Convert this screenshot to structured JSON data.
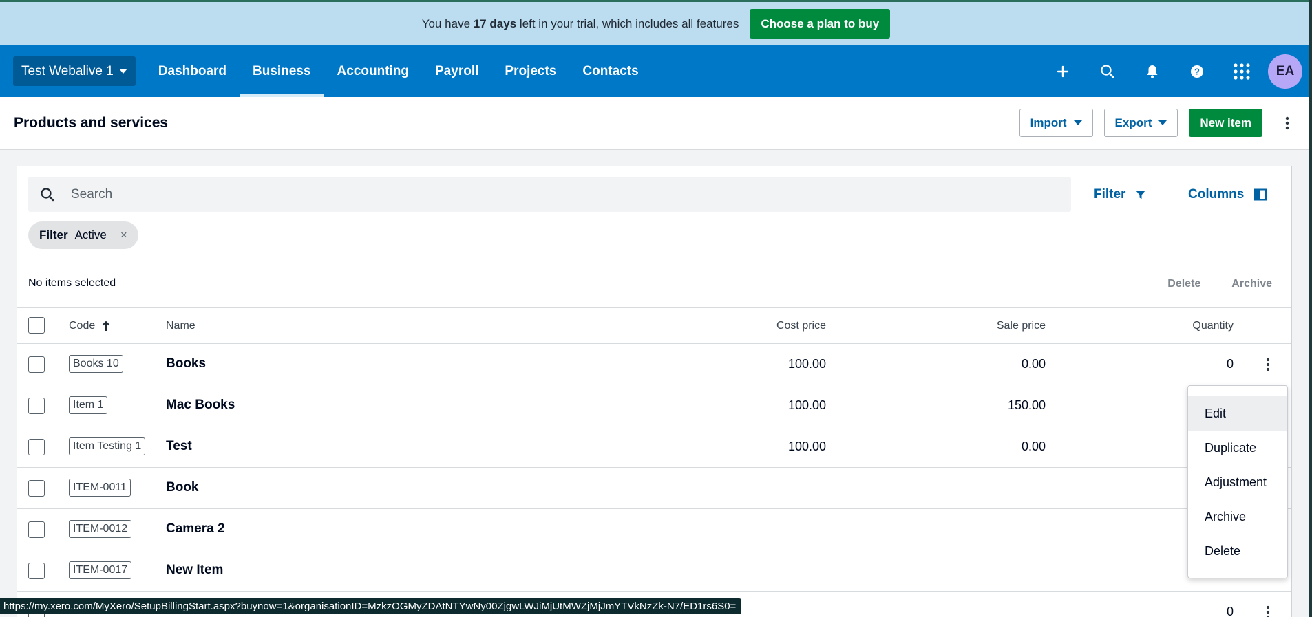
{
  "trial": {
    "pre": "You have",
    "days": "17 days",
    "post": "left in your trial, which includes all features",
    "cta": "Choose a plan to buy"
  },
  "nav": {
    "org": "Test Webalive 1",
    "links": [
      "Dashboard",
      "Business",
      "Accounting",
      "Payroll",
      "Projects",
      "Contacts"
    ],
    "active": "Business",
    "avatar": "EA",
    "accent": "#0078c8"
  },
  "page": {
    "title": "Products and services",
    "import": "Import",
    "export": "Export",
    "new_item": "New item"
  },
  "toolbar": {
    "search_placeholder": "Search",
    "filter": "Filter",
    "columns": "Columns"
  },
  "chip": {
    "label": "Filter",
    "value": "Active",
    "remove": "×"
  },
  "selection": {
    "text": "No items selected",
    "delete": "Delete",
    "archive": "Archive"
  },
  "table": {
    "headers": {
      "code": "Code",
      "name": "Name",
      "cost": "Cost price",
      "sale": "Sale price",
      "qty": "Quantity"
    },
    "rows": [
      {
        "code": "Books 10",
        "name": "Books",
        "cost": "100.00",
        "sale": "0.00",
        "qty": "0"
      },
      {
        "code": "Item 1",
        "name": "Mac Books",
        "cost": "100.00",
        "sale": "150.00",
        "qty": ""
      },
      {
        "code": "Item Testing 1",
        "name": "Test",
        "cost": "100.00",
        "sale": "0.00",
        "qty": ""
      },
      {
        "code": "ITEM-0011",
        "name": "Book",
        "cost": "",
        "sale": "",
        "qty": ""
      },
      {
        "code": "ITEM-0012",
        "name": "Camera 2",
        "cost": "",
        "sale": "",
        "qty": ""
      },
      {
        "code": "ITEM-0017",
        "name": "New Item",
        "cost": "",
        "sale": "",
        "qty": ""
      },
      {
        "code": "",
        "name": "",
        "cost": "",
        "sale": "",
        "qty": "0"
      }
    ]
  },
  "menu": {
    "items": [
      "Edit",
      "Duplicate",
      "Adjustment",
      "Archive",
      "Delete"
    ],
    "highlighted": "Edit"
  },
  "status_url": "https://my.xero.com/MyXero/SetupBillingStart.aspx?buynow=1&organisationID=MzkzOGMyZDAtNTYwNy00ZjgwLWJiMjUtMWZjMjJmYTVkNzZk-N7/ED1rs6S0="
}
